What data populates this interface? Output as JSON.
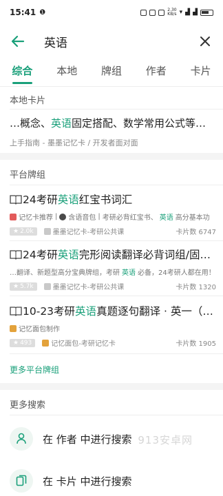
{
  "status": {
    "time": "15:41",
    "network_speed": "2.30\nKB/s"
  },
  "header": {
    "query": "英语"
  },
  "tabs": [
    "综合",
    "本地",
    "牌组",
    "作者",
    "卡片"
  ],
  "local": {
    "section_title": "本地卡片",
    "card_title_pre": "…概念、",
    "card_title_hl": "英语",
    "card_title_post": "固定搭配、数学常用公式等…",
    "card_sub": "上手指南 - 墨墨记忆卡 / 开发者面对面"
  },
  "platform": {
    "section_title": "平台牌组",
    "decks": [
      {
        "title_pre": "24考研",
        "title_hl": "英语",
        "title_post": "红宝书词汇",
        "tag1": "记忆卡推荐",
        "tag2": "含语音包",
        "tag3": "考研必背红宝书、",
        "tag3_hl": "英语",
        "tag3_post": "高分基本功",
        "rating": "2.0k",
        "owner": "墨墨记忆卡-考研公共课",
        "count": "卡片数 6747"
      },
      {
        "title_pre": "24考研",
        "title_hl": "英语",
        "title_post": "完形阅读翻译必背词组/固…",
        "tag1": "…翻译、新题型高分宝典牌组，考研",
        "tag1_hl": "英语",
        "tag1_post": "必备，24考研人都在用！",
        "rating": "5.7k",
        "owner": "墨墨记忆卡-考研公共课",
        "count": "卡片数 1320"
      },
      {
        "title_pre": "10-23考研",
        "title_hl": "英语",
        "title_post": "真题逐句翻译 · 英一（…",
        "tag1": "记忆面包制作",
        "rating": "493",
        "owner": "记忆面包-考研记忆卡",
        "count": "卡片数 1905"
      }
    ],
    "more_label": "更多平台牌组"
  },
  "more_search": {
    "section_title": "更多搜索",
    "author_option": "在 作者 中进行搜索",
    "card_option": "在 卡片 中进行搜索"
  },
  "watermark": "913安卓网",
  "colors": {
    "accent": "#1aa07a"
  }
}
